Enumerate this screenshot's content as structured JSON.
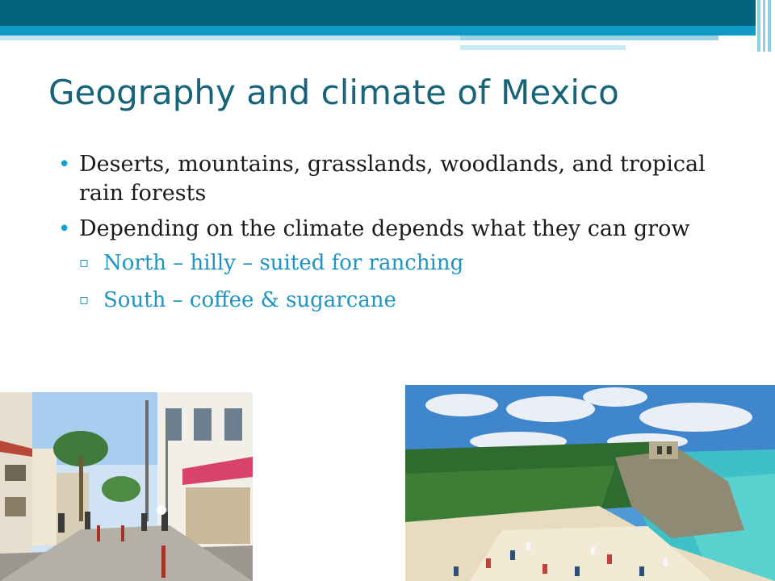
{
  "slide": {
    "title": "Geography and climate of Mexico",
    "bullets": [
      "Deserts, mountains, grasslands, woodlands, and tropical rain forests",
      "Depending on the climate depends what they can grow"
    ],
    "sub_bullets": [
      "North – hilly – suited for ranching",
      "South – coffee & sugarcane"
    ]
  },
  "colors": {
    "title": "#17647a",
    "banner_dark": "#05637e",
    "banner_mid": "#0e9ac4",
    "sub_text": "#1c94c4"
  },
  "images": [
    {
      "name": "street-photo",
      "depicts": "town street with shops and pedestrians"
    },
    {
      "name": "beach-photo",
      "depicts": "beach with ruins on a cliff and turquoise sea"
    }
  ]
}
